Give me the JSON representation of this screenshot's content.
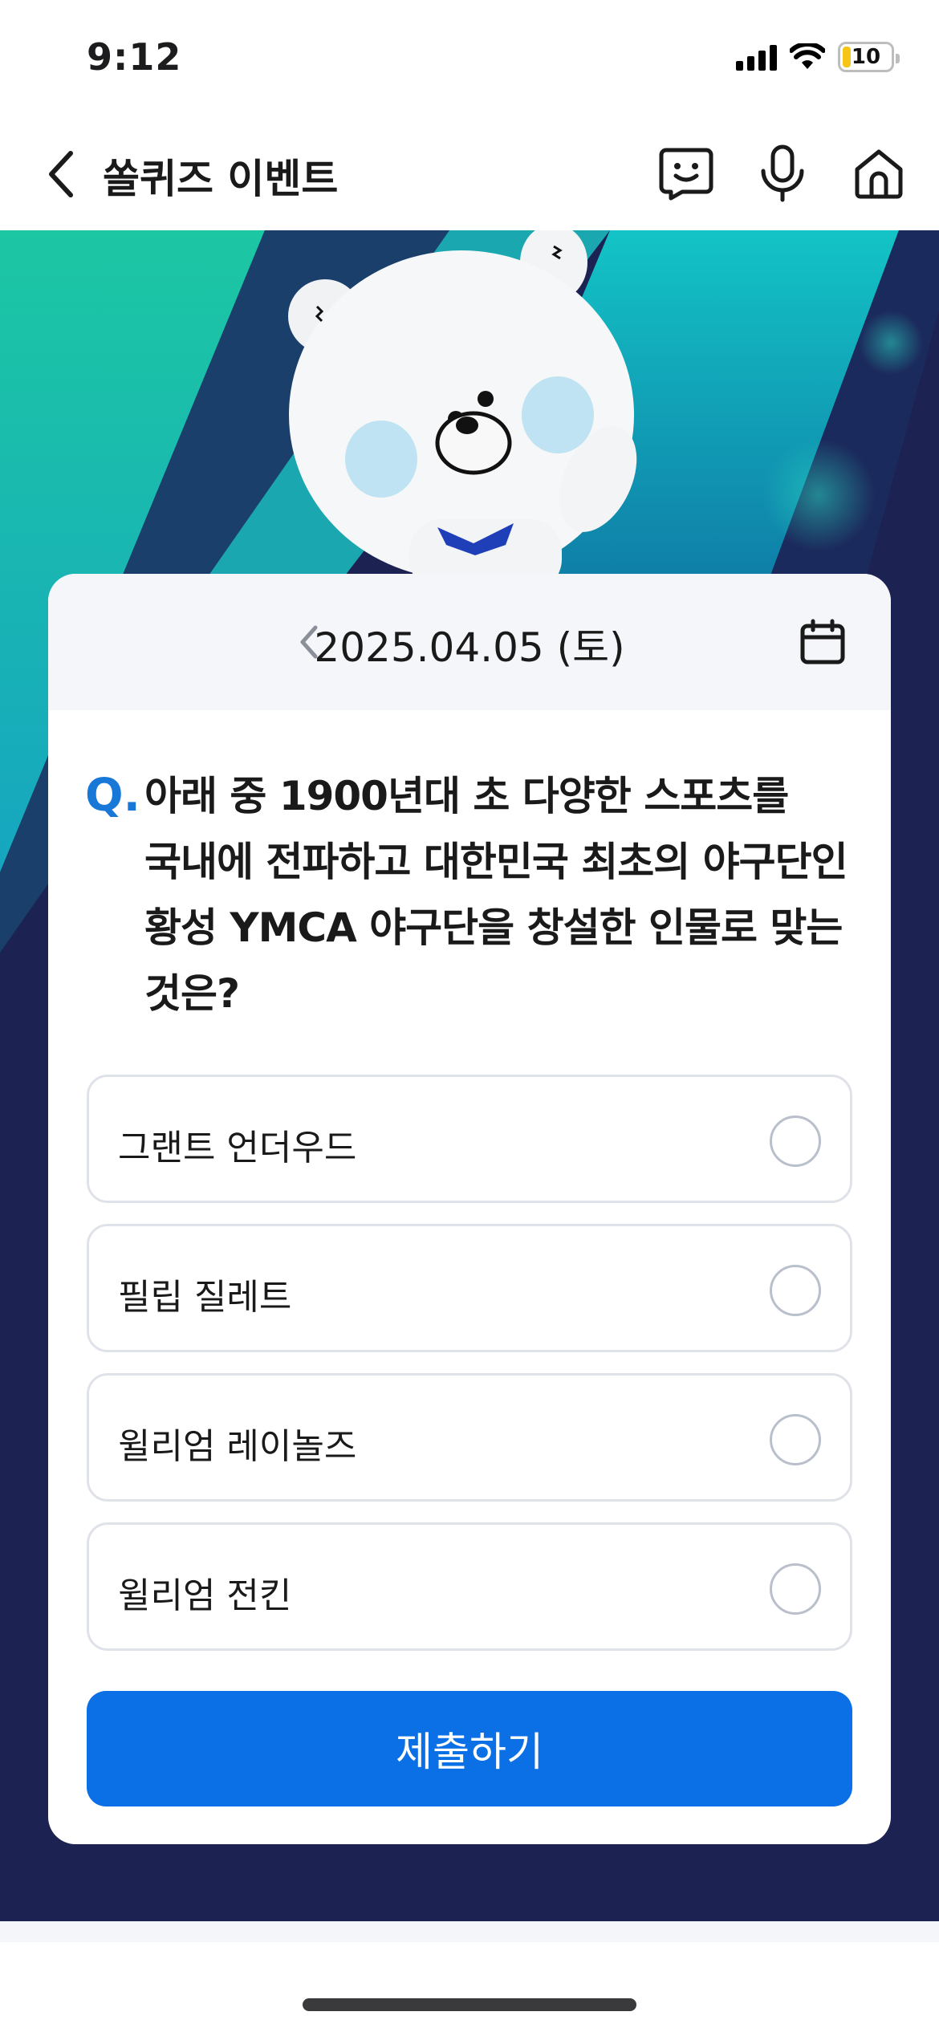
{
  "status_bar": {
    "time": "9:12",
    "battery": "10"
  },
  "header": {
    "title": "쏠퀴즈 이벤트"
  },
  "quiz": {
    "date": "2025.04.05 (토)",
    "question_prefix": "Q.",
    "question": "아래 중 1900년대 초 다양한 스포츠를 국내에 전파하고 대한민국 최초의 야구단인 황성 YMCA 야구단을 창설한 인물로 맞는 것은?",
    "options": [
      {
        "label": "그랜트 언더우드",
        "selected": false
      },
      {
        "label": "필립 질레트",
        "selected": false
      },
      {
        "label": "윌리엄 레이놀즈",
        "selected": false
      },
      {
        "label": "윌리엄 전킨",
        "selected": false
      }
    ],
    "submit_label": "제출하기"
  },
  "colors": {
    "accent": "#0b6fe6",
    "question_mark": "#1878d8",
    "battery_fill": "#f5c518",
    "hero_top": "#26bfa8",
    "hero_bottom": "#1c1a45"
  },
  "icons": {
    "back": "chevron-left-icon",
    "chat": "chat-face-icon",
    "mic": "microphone-icon",
    "home": "home-icon",
    "date_prev": "chevron-left-icon",
    "calendar": "calendar-icon"
  }
}
